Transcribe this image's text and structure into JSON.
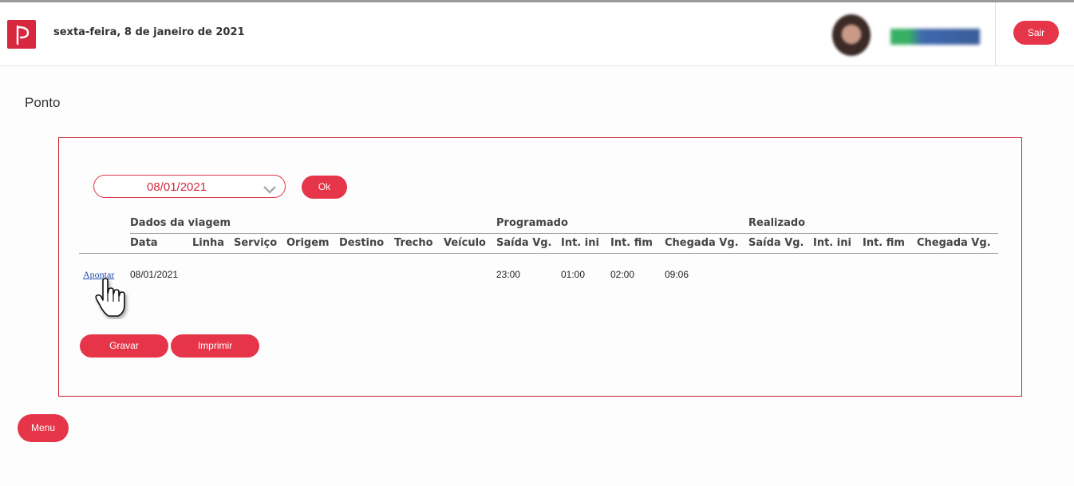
{
  "header": {
    "date": "sexta-feira, 8 de janeiro de 2021",
    "logout_label": "Sair"
  },
  "page": {
    "title": "Ponto"
  },
  "filter": {
    "selected_date": "08/01/2021",
    "ok_label": "Ok"
  },
  "table": {
    "groups": {
      "trip": "Dados da viagem",
      "scheduled": "Programado",
      "actual": "Realizado"
    },
    "columns": [
      "Data",
      "Linha",
      "Serviço",
      "Origem",
      "Destino",
      "Trecho",
      "Veículo",
      "Saída Vg.",
      "Int. ini",
      "Int. fim",
      "Chegada Vg.",
      "Saída Vg.",
      "Int. ini",
      "Int. fim",
      "Chegada Vg."
    ],
    "rows": [
      {
        "action": "Apontar",
        "cells": [
          "08/01/2021",
          "",
          "",
          "",
          "",
          "",
          "",
          "23:00",
          "01:00",
          "02:00",
          "09:06",
          "",
          "",
          "",
          ""
        ]
      }
    ]
  },
  "actions": {
    "save_label": "Gravar",
    "print_label": "Imprimir",
    "menu_label": "Menu"
  },
  "colors": {
    "accent": "#e63549",
    "panel_border": "#c9242f",
    "link": "#1f4aa8"
  },
  "icons": {
    "logo": "brand-logo-icon",
    "dropdown": "chevron-down-icon",
    "pointer": "hand-cursor-icon"
  }
}
